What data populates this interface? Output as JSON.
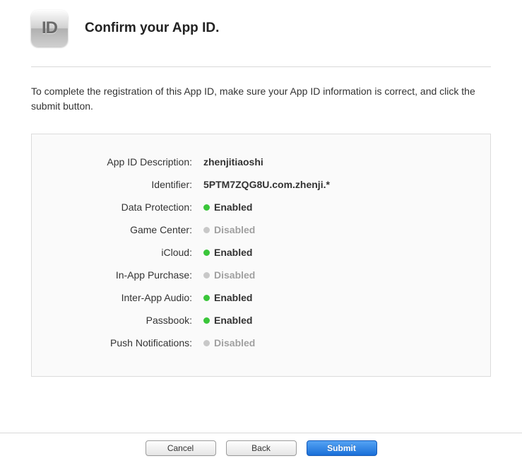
{
  "header": {
    "icon_label": "ID",
    "title": "Confirm your App ID."
  },
  "instructions": "To complete the registration of this App ID, make sure your App ID information is correct, and click the submit button.",
  "fields": {
    "description": {
      "label": "App ID Description:",
      "value": "zhenjitiaoshi"
    },
    "identifier": {
      "label": "Identifier:",
      "value": "5PTM7ZQG8U.com.zhenji.*"
    },
    "data_protection": {
      "label": "Data Protection:",
      "status": "Enabled",
      "enabled": true
    },
    "game_center": {
      "label": "Game Center:",
      "status": "Disabled",
      "enabled": false
    },
    "icloud": {
      "label": "iCloud:",
      "status": "Enabled",
      "enabled": true
    },
    "iap": {
      "label": "In-App Purchase:",
      "status": "Disabled",
      "enabled": false
    },
    "inter_app_audio": {
      "label": "Inter-App Audio:",
      "status": "Enabled",
      "enabled": true
    },
    "passbook": {
      "label": "Passbook:",
      "status": "Enabled",
      "enabled": true
    },
    "push": {
      "label": "Push Notifications:",
      "status": "Disabled",
      "enabled": false
    }
  },
  "buttons": {
    "cancel": "Cancel",
    "back": "Back",
    "submit": "Submit"
  }
}
